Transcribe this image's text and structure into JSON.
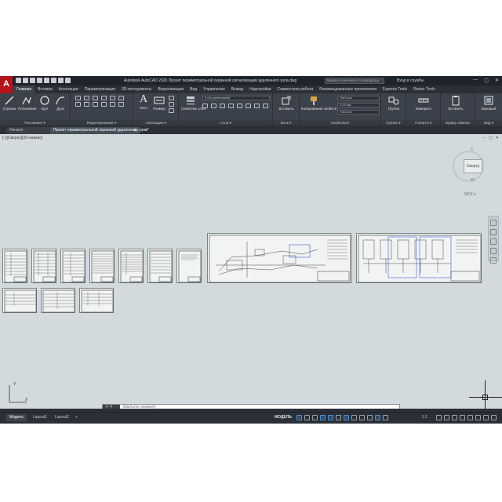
{
  "window": {
    "app_logo": "A",
    "title": "Autodesk AutoCAD 2020   Проект периметральной охранной сигнализации удаленного узла.dwg",
    "search_placeholder": "Введите ключевое слово/фразу",
    "signin_label": "Вход в службы",
    "controls": [
      "—",
      "▢",
      "✕"
    ]
  },
  "ribbon": {
    "tabs": [
      "Главная",
      "Вставка",
      "Аннотации",
      "Параметризация",
      "3D-инструменты",
      "Визуализация",
      "Вид",
      "Управление",
      "Вывод",
      "Надстройки",
      "Совместная работа",
      "Рекомендованные приложения",
      "Express Tools",
      "Raster Tools"
    ],
    "active_tab": 0,
    "panels": {
      "draw": {
        "title": "Рисование ▾",
        "tools": [
          "Отрезок",
          "Полилиния",
          "Круг",
          "Дуга"
        ]
      },
      "modify": {
        "title": "Редактирование ▾"
      },
      "annotation": {
        "title": "Аннотации ▾",
        "tools": [
          "Текст",
          "Размер"
        ]
      },
      "layers": {
        "title": "Слои ▾",
        "tools": [
          "Свойства слоя"
        ],
        "layer_combo": "0 (по умолчанию)"
      },
      "block": {
        "title": "Блок ▾",
        "tools": [
          "Вставить"
        ]
      },
      "properties": {
        "title": "Свойства ▾",
        "tools": [
          "Копирование свойств"
        ],
        "color_combo": "ПоСлою",
        "lineweight_combo": "0.00 мм",
        "linetype_combo": "ПоСлою"
      },
      "groups": {
        "title": "Группы ▾",
        "tools": [
          "Группа"
        ]
      },
      "utilities": {
        "title": "Утилиты ▾",
        "tools": [
          "Измерить"
        ]
      },
      "clipboard": {
        "title": "Буфер обмена",
        "tools": [
          "Вставить"
        ]
      },
      "view": {
        "title": "Вид ▾",
        "tools": [
          "Базовый"
        ]
      }
    }
  },
  "doc_tabs": {
    "start": "Начало",
    "file": "Проект периметральной охранной удаленного узла*",
    "close": "✕",
    "new": "+"
  },
  "viewport": {
    "label": "[–][Сверху][2D-каркас]",
    "controls": [
      "–",
      "▢",
      "✕"
    ],
    "viewcube": {
      "face": "Сверху",
      "north": "С",
      "south": "Ю",
      "wcs": "МСК ▾"
    }
  },
  "ucs": {
    "y": "Y",
    "x": "X"
  },
  "command_line": {
    "buttons": "✕ ⚲",
    "placeholder": "Введите команду"
  },
  "status_bar": {
    "layout_tabs": [
      "Модель",
      "Layout1",
      "Layout2",
      "+"
    ],
    "mode": "МОДЕЛЬ",
    "scale": "1:1"
  }
}
